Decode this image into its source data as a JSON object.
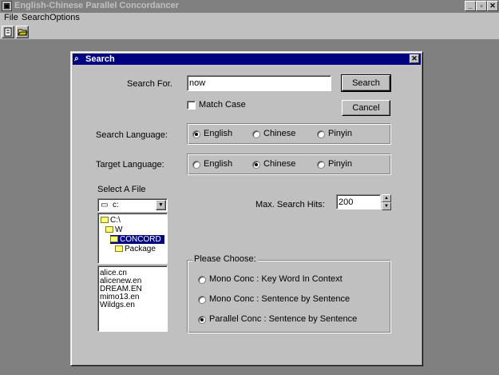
{
  "app": {
    "title": "English-Chinese Parallel Concordancer",
    "menu": [
      "File",
      "Search",
      "Options"
    ],
    "caption_buttons": {
      "minimize": "_",
      "maximize": "▫",
      "close": "✕"
    }
  },
  "dialog": {
    "title": "Search",
    "close_glyph": "✕",
    "search_for_label": "Search For.",
    "search_value": "now",
    "search_button": "Search",
    "cancel_button": "Cancel",
    "match_case_label": "Match Case",
    "match_case_checked": false,
    "search_language_label": "Search Language:",
    "search_language_options": [
      "English",
      "Chinese",
      "Pinyin"
    ],
    "search_language_selected": "English",
    "target_language_label": "Target Language:",
    "target_language_options": [
      "English",
      "Chinese",
      "Pinyin"
    ],
    "target_language_selected": "Chinese",
    "select_file_label": "Select A File",
    "drive_value": "c:",
    "directories": [
      "C:\\",
      "W",
      "CONCORD",
      "Package"
    ],
    "selected_directory": "CONCORD",
    "files": [
      "alice.cn",
      "alicenew.en",
      "DREAM.EN",
      "mimo13.en",
      "Wildgs.en"
    ],
    "max_hits_label": "Max. Search Hits:",
    "max_hits_value": "200",
    "choose_label": "Please Choose:",
    "choose_options": [
      "Mono Conc : Key Word In Context",
      "Mono Conc : Sentence by Sentence",
      "Parallel Conc : Sentence by Sentence"
    ],
    "choose_selected": "Parallel Conc : Sentence by Sentence"
  },
  "colors": {
    "desktop": "#808080",
    "dialog_title": "#000080",
    "face": "#c0c0c0",
    "highlight": "#000080"
  }
}
